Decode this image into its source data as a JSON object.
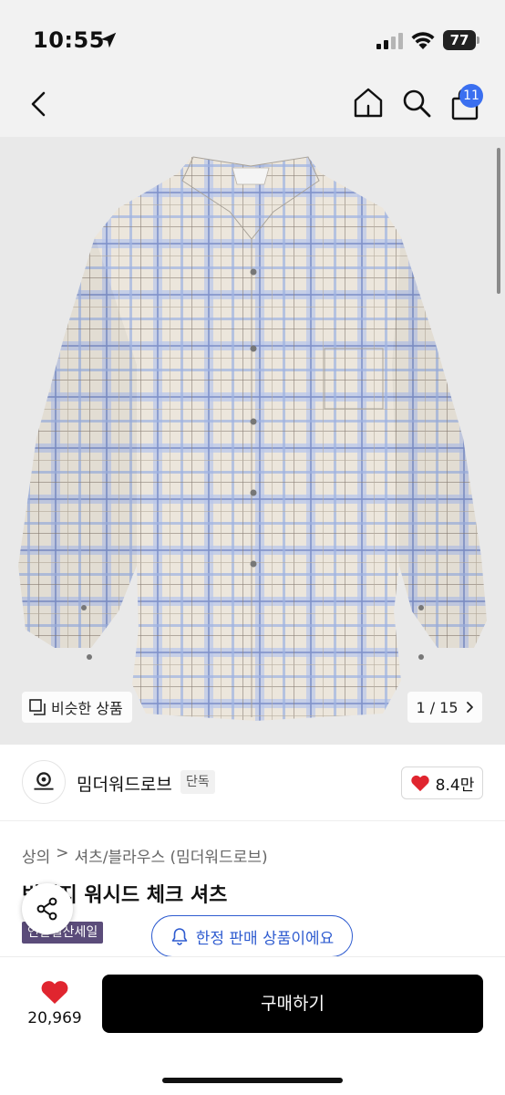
{
  "status_bar": {
    "time": "10:55",
    "battery": "77"
  },
  "nav": {
    "cart_badge": "11"
  },
  "gallery": {
    "similar_label": "비슷한 상품",
    "page_counter": "1 / 15"
  },
  "shop": {
    "name": "밈더워드로브",
    "tag": "단독",
    "like_count": "8.4만"
  },
  "breadcrumb": {
    "category": "상의",
    "separator": ">",
    "subcategory": "셔츠/블라우스 (밈더워드로브)"
  },
  "product": {
    "title": "빈티지 워시드 체크 셔츠",
    "sale_tag": "연말결산세일",
    "limited_notice": "한정 판매 상품이에요"
  },
  "bottom_bar": {
    "wish_count": "20,969",
    "buy_label": "구매하기"
  },
  "colors": {
    "accent_blue": "#2f5cd0",
    "badge_blue": "#3a6ff0",
    "heart_red": "#e0252f",
    "sale_purple": "#5b4c7a",
    "buy_black": "#000000"
  },
  "icons": [
    "location-arrow-icon",
    "signal-icon",
    "wifi-icon",
    "battery-icon",
    "back-chevron-icon",
    "home-icon",
    "search-icon",
    "shopping-bag-icon",
    "similar-products-icon",
    "chevron-right-icon",
    "heart-icon",
    "share-icon",
    "bell-icon"
  ]
}
